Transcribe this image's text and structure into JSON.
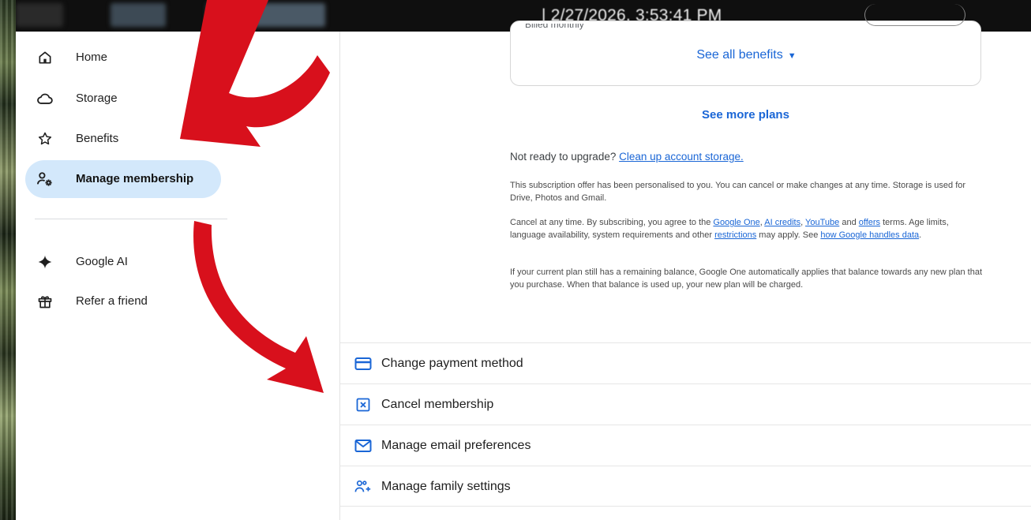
{
  "topbar": {
    "timestamp": "| 2/27/2026, 3:53:41 PM"
  },
  "sidebar": {
    "items": [
      {
        "label": "Home",
        "icon": "home-icon"
      },
      {
        "label": "Storage",
        "icon": "cloud-icon"
      },
      {
        "label": "Benefits",
        "icon": "star-icon"
      },
      {
        "label": "Manage membership",
        "icon": "manage-membership-icon",
        "active": true
      },
      {
        "label": "Google AI",
        "icon": "sparkle-icon"
      },
      {
        "label": "Refer a friend",
        "icon": "gift-icon"
      }
    ]
  },
  "plan_card": {
    "billed_text": "Billed monthly",
    "see_all_benefits": "See all benefits"
  },
  "main": {
    "see_more_plans": "See more plans",
    "not_ready_prefix": "Not ready to upgrade?",
    "clean_up_link": "Clean up account storage.",
    "para1": "This subscription offer has been personalised to you. You can cancel or make changes at any time. Storage is used for Drive, Photos and Gmail.",
    "para2": {
      "t1": "Cancel at any time. By subscribing, you agree to the ",
      "link1": "Google One",
      "t2": ", ",
      "link2": "AI credits",
      "t3": ", ",
      "link3": "YouTube",
      "t4": " and ",
      "link4": "offers",
      "t5": " terms. Age limits, language availability, system requirements and other ",
      "link5": "restrictions",
      "t6": " may apply. See ",
      "link6": "how Google handles data",
      "t7": "."
    },
    "para3": "If your current plan still has a remaining balance, Google One automatically applies that balance towards any new plan that you purchase. When that balance is used up, your new plan will be charged."
  },
  "actions": [
    {
      "label": "Change payment method",
      "icon": "credit-card-icon"
    },
    {
      "label": "Cancel membership",
      "icon": "cancel-box-icon"
    },
    {
      "label": "Manage email preferences",
      "icon": "envelope-icon"
    },
    {
      "label": "Manage family settings",
      "icon": "family-icon"
    }
  ],
  "colors": {
    "accent_blue": "#1a66d6",
    "active_nav_bg": "#d3e8fb",
    "arrow_red": "#d8101c"
  }
}
